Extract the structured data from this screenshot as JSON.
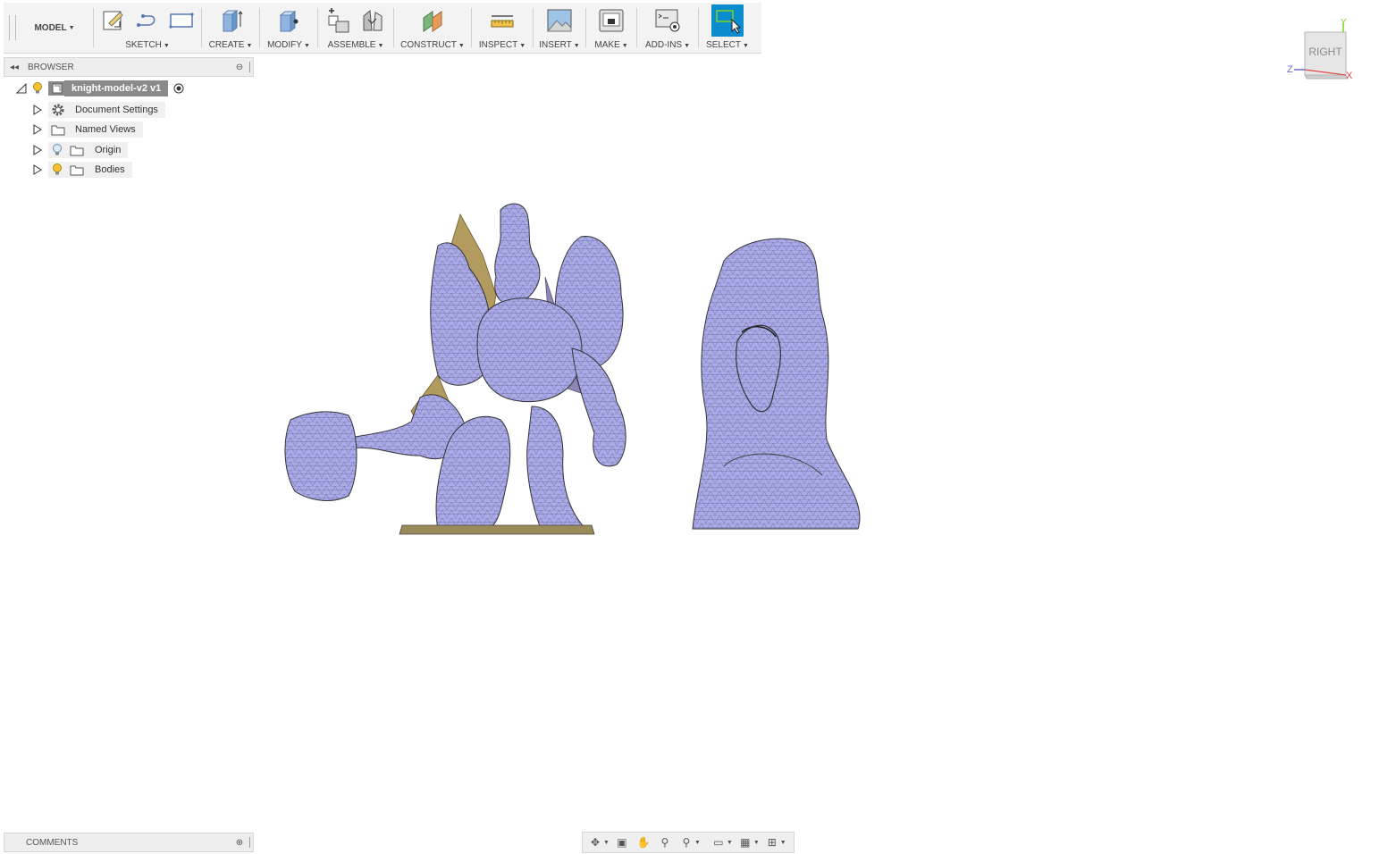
{
  "toolbar": {
    "workspace": "MODEL",
    "groups": {
      "sketch": "SKETCH",
      "create": "CREATE",
      "modify": "MODIFY",
      "assemble": "ASSEMBLE",
      "construct": "CONSTRUCT",
      "inspect": "INSPECT",
      "insert": "INSERT",
      "make": "MAKE",
      "addins": "ADD-INS",
      "select": "SELECT"
    }
  },
  "browser": {
    "title": "BROWSER",
    "root": "knight-model-v2 v1",
    "items": [
      {
        "label": "Document Settings",
        "icon": "gear-icon"
      },
      {
        "label": "Named Views",
        "icon": "folder-icon"
      },
      {
        "label": "Origin",
        "icon": "folder-icon"
      },
      {
        "label": "Bodies",
        "icon": "folder-icon"
      }
    ]
  },
  "viewcube": {
    "face": "RIGHT",
    "axis_x": "X",
    "axis_y": "Y",
    "axis_z": "Z"
  },
  "comments": {
    "title": "COMMENTS"
  },
  "colors": {
    "mesh": "#a9a9e6",
    "select_active": "#0b8ccf",
    "bulb": "#f2c230"
  }
}
